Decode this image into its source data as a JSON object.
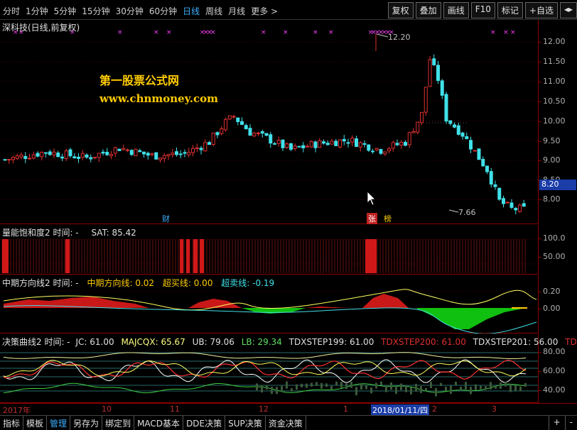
{
  "toolbar": {
    "periods": [
      {
        "label": "分时",
        "active": false
      },
      {
        "label": "1分钟",
        "active": false
      },
      {
        "label": "5分钟",
        "active": false
      },
      {
        "label": "15分钟",
        "active": false
      },
      {
        "label": "30分钟",
        "active": false
      },
      {
        "label": "60分钟",
        "active": false
      },
      {
        "label": "日线",
        "active": true
      },
      {
        "label": "周线",
        "active": false
      },
      {
        "label": "月线",
        "active": false
      },
      {
        "label": "更多 >",
        "active": false
      }
    ],
    "buttons": [
      "复权",
      "叠加",
      "画线",
      "F10",
      "标记",
      "+自选",
      "◂▸"
    ]
  },
  "main": {
    "title": "深科技(日线,前复权)",
    "logo_line1": "第一股票公式网",
    "logo_line2": "www.chnmoney.com",
    "high_label": "12.20",
    "low_label": "7.66",
    "current_price": "8.20",
    "badge_cai": "财",
    "badge_zhang": "张",
    "badge_bang": "榜",
    "axis_ticks": [
      "12.00",
      "11.50",
      "11.00",
      "10.50",
      "10.00",
      "9.50",
      "9.00",
      "8.50",
      "8.00"
    ]
  },
  "sat": {
    "title": "量能饱和度2 时间: -",
    "value": "SAT: 85.42",
    "axis_ticks": [
      "100.0",
      "50.00"
    ]
  },
  "direction": {
    "title": "中期方向线2 时间: -",
    "line_value": "中期方向线: 0.02",
    "overbought": "超买线: 0.00",
    "oversold": "超卖线: -0.19",
    "axis_ticks": [
      "0.20",
      "0.00"
    ]
  },
  "decision": {
    "title": "决策曲线2 时间: -",
    "jc": "JC: 61.00",
    "majcqx": "MAJCQX: 65.67",
    "ub": "UB: 79.06",
    "lb": "LB: 29.34",
    "s199": "TDXSTEP199: 61.00",
    "s200": "TDXSTEP200: 61.00",
    "s201": "TDXSTEP201: 56.00",
    "s202": "TDXSTE",
    "axis_ticks": [
      "80.00",
      "60.00",
      "40.00"
    ]
  },
  "datebar": {
    "labels": [
      "2017年",
      "10",
      "11",
      "12",
      "1",
      "2018/01/11/四",
      "2",
      "3"
    ]
  },
  "tabs": {
    "items": [
      {
        "label": "指标",
        "active": false
      },
      {
        "label": "模板",
        "active": false
      },
      {
        "label": "管理",
        "active": true
      },
      {
        "label": "另存为",
        "active": false
      },
      {
        "label": "绑定到",
        "active": false
      },
      {
        "label": "MACD基本",
        "active": false
      },
      {
        "label": "DDE决策",
        "active": false
      },
      {
        "label": "SUP决策",
        "active": false
      },
      {
        "label": "资金决策",
        "active": false
      }
    ],
    "right": [
      "+",
      "-"
    ]
  },
  "colors": {
    "up": "#e03030",
    "down": "#40e0e8",
    "grid": "#8b0000",
    "highlight": "#1a3da8",
    "yellow": "#ffcc00",
    "magenta": "#ff40ff"
  }
}
